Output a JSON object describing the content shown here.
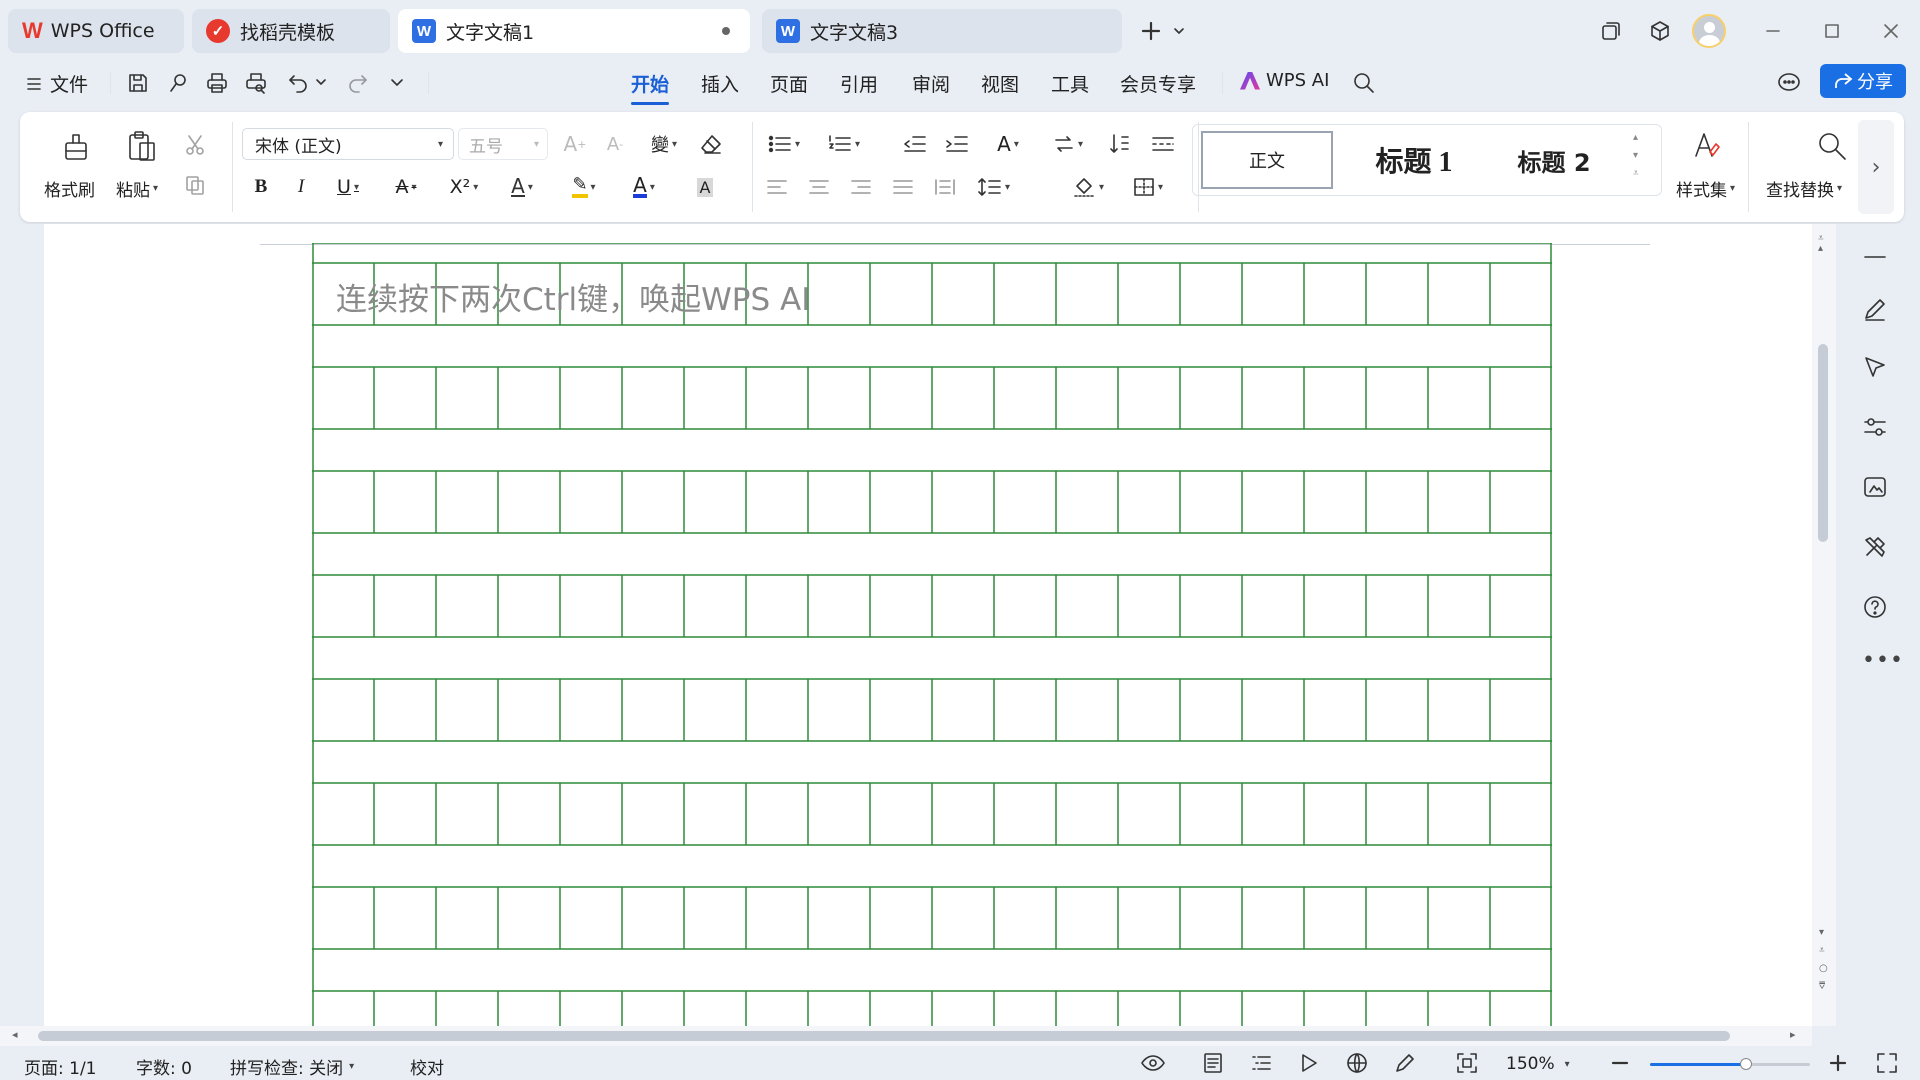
{
  "tabs": [
    {
      "label": "WPS Office",
      "icon": "wps-logo-icon"
    },
    {
      "label": "找稻壳模板",
      "icon": "docer-icon"
    },
    {
      "label": "文字文稿1",
      "icon": "writer-doc-icon"
    },
    {
      "label": "文字文稿3",
      "icon": "writer-doc-icon"
    }
  ],
  "menu": {
    "file_label": "文件",
    "tabs": [
      "开始",
      "插入",
      "页面",
      "引用",
      "审阅",
      "视图",
      "工具",
      "会员专享"
    ],
    "active_tab": "开始",
    "wps_ai_label": "WPS AI",
    "share_label": "分享"
  },
  "ribbon": {
    "format_painter": "格式刷",
    "paste": "粘贴",
    "font_name": "宋体 (正文)",
    "font_size": "五号",
    "styles": [
      "正文",
      "标题 1",
      "标题 2"
    ],
    "style_set": "样式集",
    "find_replace": "查找替换"
  },
  "document": {
    "placeholder": "连续按下两次Ctrl键，唤起WPS AI",
    "grid_color": "#2e8b3a"
  },
  "status": {
    "page": "页面: 1/1",
    "word_count": "字数: 0",
    "spell_check": "拼写检查: 关闭",
    "proofread": "校对",
    "zoom": "150%",
    "zoom_fraction": 0.6
  },
  "colors": {
    "accent": "#1b5fd6",
    "background": "#e9edf4",
    "wps_red": "#e8392f",
    "writer_blue": "#2f6fe4"
  }
}
